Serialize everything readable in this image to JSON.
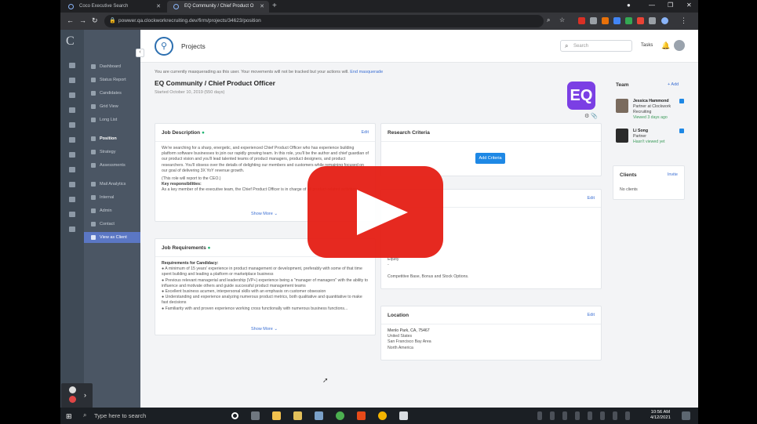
{
  "browser": {
    "tabs": [
      {
        "label": "Coco Executive Search"
      },
      {
        "label": "EQ Community / Chief Product O"
      }
    ],
    "url": "powwer.qa.clockworkrecruiting.dev/firm/projects/34623/position"
  },
  "sidebar": {
    "items": [
      {
        "label": "Dashboard"
      },
      {
        "label": "Status Report"
      },
      {
        "label": "Candidates"
      },
      {
        "label": "Grid View"
      },
      {
        "label": "Long List"
      },
      {
        "label": "Position"
      },
      {
        "label": "Strategy"
      },
      {
        "label": "Assessments"
      },
      {
        "label": "Mail Analytics"
      },
      {
        "label": "Internal"
      },
      {
        "label": "Admin"
      },
      {
        "label": "Contact"
      },
      {
        "label": "View as Client"
      }
    ]
  },
  "header": {
    "title": "Projects",
    "search_placeholder": "Search",
    "tasks_label": "Tasks"
  },
  "position": {
    "masquerade_text": "You are currently masquerading as this user. Your movements will not be tracked but your actions will.",
    "masquerade_link": "End masquerade",
    "breadcrumb": "EQ Community / Chief Product Officer",
    "started": "Started October 10, 2019 (550 days)",
    "logo_text": "EQ"
  },
  "job_description": {
    "title": "Job Description",
    "edit": "Edit",
    "paragraph": "We're searching for a sharp, energetic, and experienced Chief Product Officer who has experience building platform software businesses to join our rapidly growing team. In this role, you'll be the author and chief guardian of our product vision and you'll lead talented teams of product managers, product designers, and product researchers. You'll obsess over the details of delighting our members and customers while remaining focused on our goal of delivering 3X YoY revenue growth.",
    "note": "(This role will report to the CEO.)",
    "key_heading": "Key responsibilities:",
    "key_text": "As a key member of the executive team, the Chief Product Officer is in charge of all product-related activities...",
    "show_more": "Show More"
  },
  "job_requirements": {
    "title": "Job Requirements",
    "heading": "Requirements for Candidacy:",
    "items": [
      "● A minimum of 15 years' experience in product management or development, preferably with some of that time spent building and leading a platform or marketplace business",
      "● Previous relevant managerial and leadership (VP+) experience being a \"manager of managers\" with the ability to influence and motivate others and guide successful product management teams",
      "● Excellent business acumen, interpersonal skills with an emphasis on customer obsession",
      "● Understanding and experience analyzing numerous product metrics, both qualitative and quantitative to make fast decisions",
      "● Familiarity with and proven experience working cross functionally with numerous business functions..."
    ],
    "show_more": "Show More"
  },
  "research_criteria": {
    "title": "Research Criteria",
    "button": "Add Criteria"
  },
  "compensation": {
    "edit": "Edit",
    "equity_label": "Equity",
    "equity_value": "-",
    "note": "Competitive Base, Bonus and Stock Options."
  },
  "location": {
    "title": "Location",
    "edit": "Edit",
    "lines": [
      "Menlo Park, CA, 75467",
      "United States",
      "San Francisco Bay Area",
      "North America"
    ]
  },
  "team": {
    "title": "Team",
    "add": "+ Add",
    "members": [
      {
        "name": "Jessica Hammond",
        "role": "Partner at Clockwork Recruiting",
        "viewed": "Viewed 3 days ago"
      },
      {
        "name": "Li Song",
        "role": "Partner",
        "viewed": "Hasn't viewed yet"
      }
    ]
  },
  "clients": {
    "title": "Clients",
    "invite": "Invite",
    "empty": "No clients"
  },
  "taskbar": {
    "search_placeholder": "Type here to search",
    "time": "10:56 AM",
    "date": "4/12/2021"
  },
  "colors": {
    "brand_logo": "#7b3fe4",
    "link": "#3b6fd3",
    "play_button": "#e62117",
    "sidebar": "#4b5664"
  }
}
